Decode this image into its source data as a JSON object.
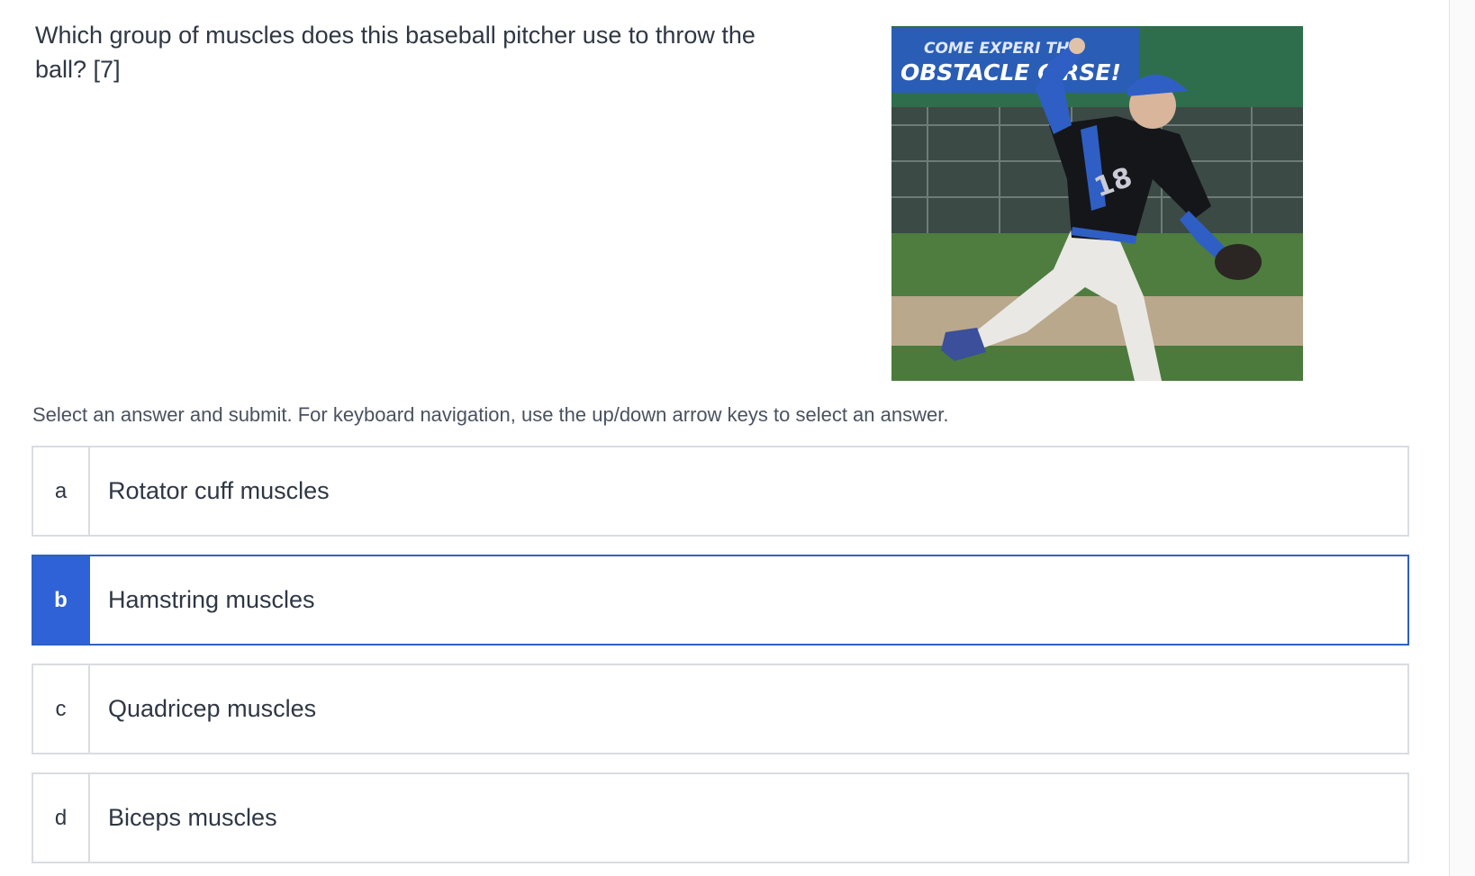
{
  "question": {
    "text": "Which group of muscles does this baseball pitcher use to throw the ball? [7]"
  },
  "photo": {
    "banner_line1": "COME EXPERI THE",
    "banner_line2": "OBSTACLE C RSE!",
    "jersey_number": "18"
  },
  "instructions": "Select an answer and submit. For keyboard navigation, use the up/down arrow keys to select an answer.",
  "options": [
    {
      "letter": "a",
      "label": "Rotator cuff muscles",
      "selected": false
    },
    {
      "letter": "b",
      "label": "Hamstring muscles",
      "selected": true
    },
    {
      "letter": "c",
      "label": "Quadricep muscles",
      "selected": false
    },
    {
      "letter": "d",
      "label": "Biceps muscles",
      "selected": false
    }
  ],
  "colors": {
    "selected_accent": "#2f62d6",
    "border": "#d9dce1",
    "text": "#2f3744"
  }
}
